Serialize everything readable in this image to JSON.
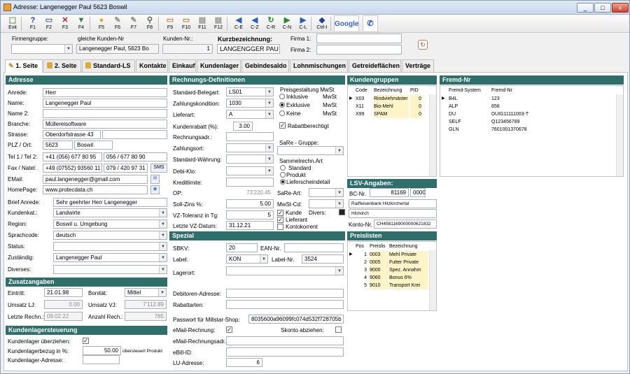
{
  "window": {
    "title": "Adresse: Langenegger  Paul 5623 Boswil",
    "min": "_",
    "max": "□",
    "close": "x"
  },
  "toolbar": [
    {
      "label": "Exit",
      "icon": "exit-icon",
      "glyph": "⬚",
      "color": "#2a7a2a"
    },
    {
      "label": "F1",
      "icon": "help-icon",
      "glyph": "?",
      "color": "#2040a0"
    },
    {
      "label": "F2",
      "icon": "new-document-icon",
      "glyph": "▭",
      "color": "#507080"
    },
    {
      "label": "F3",
      "icon": "delete-icon",
      "glyph": "✕",
      "color": "#c02020"
    },
    {
      "label": "F4",
      "icon": "save-icon",
      "glyph": "▼",
      "color": "#2a8a2a"
    },
    {
      "label": "F5",
      "icon": "lightbulb-icon",
      "glyph": "●",
      "color": "#e0b020"
    },
    {
      "label": "F6",
      "icon": "tools-icon",
      "glyph": "✎",
      "color": "#909090"
    },
    {
      "label": "F7",
      "icon": "edit-icon",
      "glyph": "✎",
      "color": "#909090"
    },
    {
      "label": "F8",
      "icon": "search-icon",
      "glyph": "⚲",
      "color": "#606060"
    },
    {
      "label": "F9",
      "icon": "page-icon",
      "glyph": "▭",
      "color": "#d08030"
    },
    {
      "label": "F10",
      "icon": "page-icon",
      "glyph": "▭",
      "color": "#d08030"
    },
    {
      "label": "F11",
      "icon": "print-icon",
      "glyph": "▤",
      "color": "#909090"
    },
    {
      "label": "F12",
      "icon": "print-icon",
      "glyph": "▤",
      "color": "#909090"
    },
    {
      "label": "C-E",
      "icon": "first-record-icon",
      "glyph": "◀",
      "color": "#2060c0"
    },
    {
      "label": "C-Z",
      "icon": "previous-record-icon",
      "glyph": "◀",
      "color": "#2060c0"
    },
    {
      "label": "C-R",
      "icon": "refresh-icon",
      "glyph": "↻",
      "color": "#2a8a2a"
    },
    {
      "label": "C-N",
      "icon": "next-record-icon",
      "glyph": "▶",
      "color": "#2a8a2a"
    },
    {
      "label": "C-L",
      "icon": "last-record-icon",
      "glyph": "▶",
      "color": "#2060c0"
    },
    {
      "label": "Ctrl-I",
      "icon": "info-icon",
      "glyph": "◆",
      "color": "#2040a0"
    },
    {
      "label": "Google",
      "icon": "google-icon",
      "glyph": "",
      "color": "#000"
    },
    {
      "label": "",
      "icon": "phone-icon",
      "glyph": "✆",
      "color": "#2060c0"
    }
  ],
  "top": {
    "firmengruppe_label": "Firmengruppe:",
    "firmengruppe_value": "",
    "gleiche_label": "gleiche Kunden-Nr",
    "gleiche_value": "Langenegger  Paul, 5623 Bo",
    "kundennr_label": "Kunden-Nr.:",
    "kundennr_value": "1",
    "kurz_label": "Kurzbezeichnung:",
    "kurz_value": "LANGENGGER PAU",
    "firma1_label": "Firma 1:",
    "firma1_value": "",
    "firma2_label": "Firma 2:",
    "firma2_value": ""
  },
  "tabs": [
    "1. Seite",
    "2. Seite",
    "Standard-LS",
    "Kontakte",
    "Einkauf",
    "Kundenlager",
    "Gebindesaldo",
    "Lohnmischungen",
    "Getreideflächen",
    "Verträge"
  ],
  "adresse": {
    "title": "Adresse",
    "anrede_label": "Anrede:",
    "anrede": "Herr",
    "name_label": "Name:",
    "name": "Langenegger  Paul",
    "name2_label": "Name 2:",
    "name2": "",
    "branche_label": "Branche:",
    "branche": "Müllereisoftware",
    "strasse_label": "Strasse:",
    "strasse": "Oberdorfstrasse 43",
    "strasse2": "",
    "plz_label": "PLZ / Ort:",
    "plz": "5623",
    "ort": "Boswil",
    "tel_label": "Tel 1 / Tel 2:",
    "tel1": "+41 (056) 677 80 95",
    "tel2": "056 / 677 80 90",
    "fax_label": "Fax / Natel:",
    "fax": "+49 (07552) 93560 11",
    "natel": "079 / 420 97 31",
    "sms": "SMS",
    "email_label": "EMail:",
    "email": "paul.langenegger@gmail.com",
    "homepage_label": "HomePage:",
    "homepage": "www.protecdata.ch",
    "brief_label": "Brief Anrede:",
    "brief": "Sehr geehrter Herr Langenegger",
    "kundenkat_label": "Kundenkat.:",
    "kundenkat": "Landwirte",
    "region_label": "Region:",
    "region": "Boswil u. Umgebung",
    "sprache_label": "Sprachcode:",
    "sprache": "deutsch",
    "status_label": "Status:",
    "status": "",
    "zustaendig_label": "Zuständig:",
    "zustaendig": "Langenegger Paul",
    "diverses_label": "Diverses:",
    "diverses": ""
  },
  "zusatz": {
    "title": "Zusatzangaben",
    "eintritt_label": "Eintritt:",
    "eintritt": "21.01.98",
    "bonitaet_label": "Bonität:",
    "bonitaet": "Mittel",
    "umsatz_lj_label": "Umsatz LJ:",
    "umsatz_lj": "0.00",
    "umsatz_vj_label": "Umsatz VJ:",
    "umsatz_vj": "7'112.89",
    "letzte_label": "Letzte Rechn.:",
    "letzte": "09.02.22",
    "anzahl_label": "Anzahl Rech.:",
    "anzahl": "765"
  },
  "kundenlager": {
    "title": "Kundenlagersteuerung",
    "ueberziehen_label": "Kundenlager überziehen:",
    "ueberziehen": "✓",
    "bezug_label": "Kundenlagerbezug in %:",
    "bezug": "50.00",
    "bezug_note": "übersteuert Produkt",
    "adresse_label": "Kundenlager-Adresse:",
    "adresse": ""
  },
  "rechnung": {
    "title": "Rechnungs-Definitionen",
    "beleg_label": "Standard-Belegart:",
    "beleg": "LS01",
    "zahl_label": "Zahlungskondition:",
    "zahl": "1030",
    "liefer_label": "Lieferart:",
    "liefer": "A",
    "preis_title": "Preisgestaltung MwSt",
    "inkl": "Inklusive",
    "exkl": "Exklusive",
    "keine": "Keine",
    "mwst": "MwSt",
    "rabatt_label": "Kundenrabatt (%):",
    "rabatt": "3.00",
    "rabattber": "Rabattberechtigt",
    "rechadr_label": "Rechnungsadr.:",
    "rechadr": "",
    "zahlort_label": "Zahlungsort:",
    "zahlort": "",
    "sare_label": "SaRe - Gruppe:",
    "sare": "",
    "waehr_label": "Standard-Währung:",
    "waehr": "",
    "sammel_title": "Sammelrechn.Art",
    "standard": "Standard",
    "produkt": "Produkt",
    "lieferschein": "Lieferscheindetail",
    "debi_label": "Debi-Kto:",
    "debi": "",
    "kredit_label": "Kreditlimite:",
    "kredit": "",
    "op_label": "OP:",
    "op": "73'220.45",
    "sare_art_label": "SaRe-Art:",
    "sare_art": "",
    "soll_label": "Soll-Zins %:",
    "soll": "5.00",
    "mwst_cd_label": "MwSt-Cd:",
    "mwst_cd": "",
    "vz_label": "VZ-Toleranz in Tg:",
    "vz": "5",
    "kunde": "Kunde",
    "divers": "Divers:",
    "lieferant": "Lieferant",
    "kontokorrent": "Kontokorrent",
    "lvz_label": "Letzte VZ-Datum:",
    "lvz": "31.12.21"
  },
  "spezial": {
    "title": "Spezial",
    "sbkv_label": "SBKV:",
    "sbkv": "20",
    "ean_label": "EAN-Nr.",
    "ean": "",
    "label_label": "Label:",
    "label": "KON",
    "labelnr_label": "Label-Nr.",
    "labelnr": "3524",
    "lagerort_label": "Lagerort:",
    "lagerort": "",
    "debadr_label": "Debitoren-Adresse:",
    "debadr": "",
    "rabattarten_label": "Rabattarten:",
    "rabattarten": "",
    "pw_label": "Passwort für Millstar-Shop:",
    "pw": "8035600a96099fc074d532f728705b",
    "emailrech_label": "eMail-Rechnung:",
    "emailrech": "✓",
    "skonto_label": "Skonto abziehen:",
    "skonto": "",
    "emailadr_label": "eMail-Rechnungsadr.",
    "emailadr": "",
    "ebill_label": "eBill-ID:",
    "ebill": "",
    "lu_label": "LU-Adresse:",
    "lu": "6"
  },
  "kundengruppen": {
    "title": "Kundengruppen",
    "cols": [
      "Code",
      "Bezeichnung",
      "PID"
    ],
    "rows": [
      [
        "X03",
        "Rindviehmäster",
        "0"
      ],
      [
        "X11",
        "Bio-Mehl",
        "0"
      ],
      [
        "X99",
        "SPAM",
        "0"
      ]
    ]
  },
  "lsv": {
    "title": "LSV-Angaben:",
    "bc_label": "BC-Nr.",
    "bc": "81169",
    "bc2": "0000",
    "bank": "Raiffeisenbank Hitzkirchertal",
    "ort": "Hitzkirch",
    "konto_label": "Konto-Nr.",
    "konto": "CH4581169000000621832"
  },
  "preislisten": {
    "title": "Preislisten",
    "cols": [
      "Pos",
      "Preislis",
      "Bezeichnung"
    ],
    "rows": [
      [
        "1",
        "0003",
        "Mehl Private"
      ],
      [
        "2",
        "0005",
        "Futter Private"
      ],
      [
        "3",
        "9000",
        "Spez. Annahm"
      ],
      [
        "4",
        "9060",
        "Bonus 6%"
      ],
      [
        "5",
        "9010",
        "Transport Krei"
      ]
    ]
  },
  "fremd": {
    "title": "Fremd-Nr",
    "cols": [
      "Fremd-System",
      "Fremd-Nr"
    ],
    "rows": [
      [
        "B4L",
        "123"
      ],
      [
        "ALP",
        "658"
      ],
      [
        "DU",
        "DUIG11111003-T"
      ],
      [
        "SELF",
        "Q123456789"
      ],
      [
        "GLN",
        "7601001370678"
      ]
    ]
  }
}
